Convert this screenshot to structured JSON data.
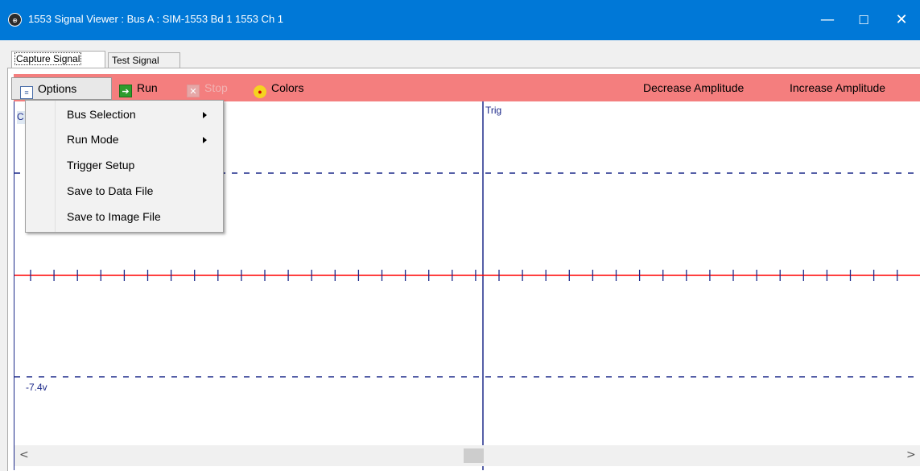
{
  "window": {
    "title": "1553 Signal Viewer : Bus A : SIM-1553 Bd 1 1553 Ch 1",
    "icon": "app-icon",
    "minimize": "—",
    "maximize": "☐",
    "close": "✕"
  },
  "tabs": [
    {
      "label": "Capture Signal",
      "active": true
    },
    {
      "label": "Test Signal",
      "active": false
    }
  ],
  "toolbar": {
    "background": "#f47e7e",
    "options_label": "Options",
    "run_label": "Run",
    "stop_label": "Stop",
    "colors_label": "Colors",
    "decrease_label": "Decrease Amplitude",
    "increase_label": "Increase Amplitude"
  },
  "menu": {
    "items": [
      {
        "label": "Bus Selection",
        "submenu": true
      },
      {
        "label": "Run Mode",
        "submenu": true
      },
      {
        "label": "Trigger Setup",
        "submenu": false
      },
      {
        "label": "Save to Data File",
        "submenu": false
      },
      {
        "label": "Save to Image File",
        "submenu": false
      }
    ]
  },
  "scope": {
    "trigger_label": "Trig",
    "lower_voltage_label": "-7.4v",
    "hidden_left_char": "C",
    "center_line_color": "#ff0000",
    "axis_color": "#1d2a8a"
  },
  "scrollbar": {
    "left_arrow": "<",
    "right_arrow": ">"
  }
}
